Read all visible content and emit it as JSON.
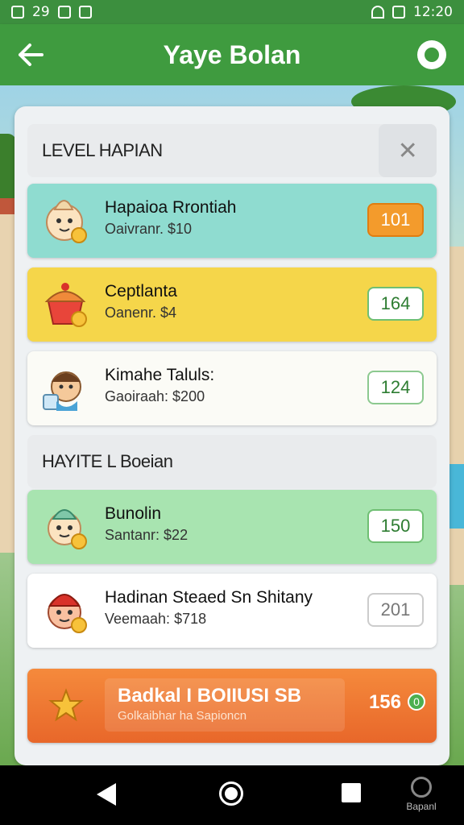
{
  "status_bar": {
    "left_text": "29",
    "time": "12:20"
  },
  "app_bar": {
    "title": "Yaye Bolan",
    "back_icon": "arrow-left-icon",
    "menu_icon": "settings-icon"
  },
  "sections": [
    {
      "header": "LEVEL HAPIAN",
      "close_symbol": "✕",
      "items": [
        {
          "name": "Hapaioa Rrontiah",
          "sub": "Oaivranr. $10",
          "value": "101",
          "bg": "#8fdcd0",
          "value_bg": "#f39b2c",
          "value_color": "#ffffff",
          "value_border": "#e07d10"
        },
        {
          "name": "Ceptlanta",
          "sub": "Oanenr. $4",
          "value": "164",
          "bg": "#f5d64a",
          "value_bg": "#ffffff",
          "value_color": "#2e7d32",
          "value_border": "#6fbf73"
        },
        {
          "name": "Kimahe Taluls:",
          "sub": "Gaoiraah: $200",
          "value": "124",
          "bg": "#fbfbf6",
          "value_bg": "#ffffff",
          "value_color": "#2e7d32",
          "value_border": "#8cc98f"
        }
      ]
    },
    {
      "header": "HAYITE L Boeian",
      "items": [
        {
          "name": "Bunolin",
          "sub": "Santanr: $22",
          "value": "150",
          "bg": "#a8e4b0",
          "value_bg": "#ffffff",
          "value_color": "#2e7d32",
          "value_border": "#6fbf73"
        },
        {
          "name": "Hadinan Steaed Sn Shitany",
          "sub": "Veemaah: $718",
          "value": "201",
          "bg": "#ffffff",
          "value_bg": "#ffffff",
          "value_color": "#777777",
          "value_border": "#cccccc"
        }
      ]
    }
  ],
  "bonus": {
    "title": "Badkal I BOIIUSI SB",
    "subtitle": "Golkaibhar ha Sapioncn",
    "value": "156",
    "icon_text": "0"
  },
  "nav": {
    "extra_label": "Bapanl"
  }
}
